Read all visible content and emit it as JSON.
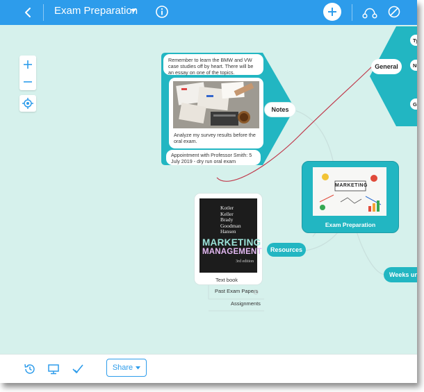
{
  "window": {
    "title": "Exam Preparation"
  },
  "toolbar": {
    "back_icon": "chevron-left-icon",
    "title_caret_icon": "caret-down-icon",
    "info_icon": "info-icon",
    "add_icon": "plus-icon",
    "share_network_icon": "share-network-icon",
    "disable_icon": "no-entry-icon"
  },
  "zoom": {
    "in_icon": "plus-icon",
    "out_icon": "minus-icon",
    "locate_icon": "crosshair-icon"
  },
  "mindmap": {
    "center": {
      "label": "Exam Preparation",
      "image_word": "MARKETING"
    },
    "notes": {
      "label": "Notes",
      "items": [
        "Remember to learn the BMW and VW case studies off by heart. There will be an essay on one of the topics.",
        "Analyze my survey results before the oral exam.",
        "Appointment with Professor Smith: 5 July 2019 - dry run oral exam"
      ]
    },
    "general": {
      "label": "General",
      "partial_items": [
        "Type",
        "Num",
        "Grad"
      ]
    },
    "resources": {
      "label": "Resources",
      "book": {
        "authors": [
          "Kotler",
          "Keller",
          "Brady",
          "Goodman",
          "Hansen"
        ],
        "title_line1": "MARKETING",
        "title_line2": "MANAGEMENT",
        "edition": "3rd edition"
      },
      "items": [
        "Text book",
        "Past Exam Papers",
        "Assignments"
      ]
    },
    "weeks": {
      "label": "Weeks until e"
    }
  },
  "bottom": {
    "history_icon": "history-icon",
    "present_icon": "presentation-icon",
    "tasks_icon": "checkmark-icon",
    "share_label": "Share"
  },
  "colors": {
    "toolbar": "#2d9ceb",
    "canvas": "#d6f1ec",
    "teal": "#22b6c2",
    "link_red": "#c0394b"
  }
}
